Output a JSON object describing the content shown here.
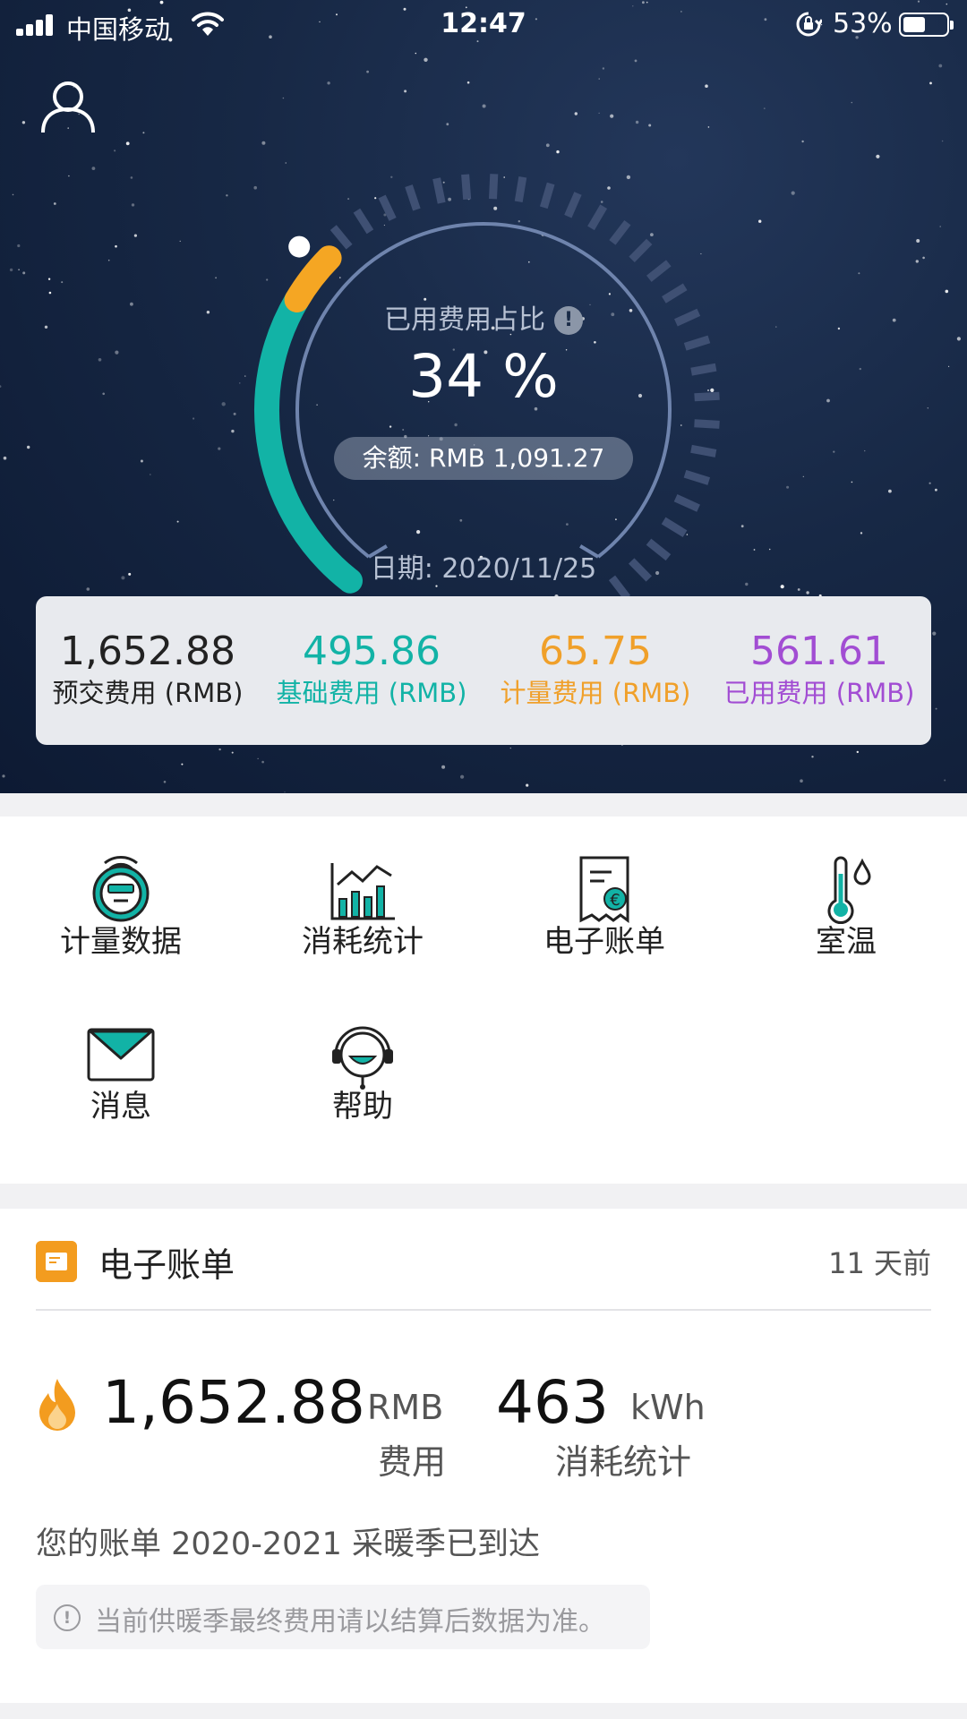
{
  "status_bar": {
    "carrier": "中国移动",
    "time": "12:47",
    "battery_percent": "53%",
    "battery_level": 0.53,
    "signal_bars": 4
  },
  "gauge": {
    "title": "已用费用占比",
    "percent_text": "34 %",
    "percent_value": 34,
    "balance": "余额: RMB 1,091.27",
    "date": "日期: 2020/11/25",
    "colors": {
      "teal": "#12b3a6",
      "orange": "#f5a623",
      "ring": "#6f84ad",
      "ticks": "#3f5073"
    }
  },
  "fees": [
    {
      "value": "1,652.88",
      "label": "预交费用 (RMB)",
      "color": "#222222"
    },
    {
      "value": "495.86",
      "label": "基础费用 (RMB)",
      "color": "#12b3a6"
    },
    {
      "value": "65.75",
      "label": "计量费用 (RMB)",
      "color": "#f0a02a"
    },
    {
      "value": "561.61",
      "label": "已用费用 (RMB)",
      "color": "#a24dd3"
    }
  ],
  "functions": [
    {
      "label": "计量数据",
      "icon": "meter-device-icon"
    },
    {
      "label": "消耗统计",
      "icon": "bar-chart-icon"
    },
    {
      "label": "电子账单",
      "icon": "euro-receipt-icon"
    },
    {
      "label": "室温",
      "icon": "thermometer-icon"
    },
    {
      "label": "消息",
      "icon": "envelope-icon"
    },
    {
      "label": "帮助",
      "icon": "headset-support-icon"
    }
  ],
  "bill": {
    "title": "电子账单",
    "time_ago": "11 天前",
    "cost_value": "1,652.88",
    "cost_unit": "RMB",
    "cost_label": "费用",
    "usage_value": "463",
    "usage_unit": "kWh",
    "usage_label": "消耗统计",
    "message": "您的账单 2020-2021 采暖季已到达",
    "note": "当前供暖季最终费用请以结算后数据为准。",
    "accent": "#f39c1f"
  }
}
